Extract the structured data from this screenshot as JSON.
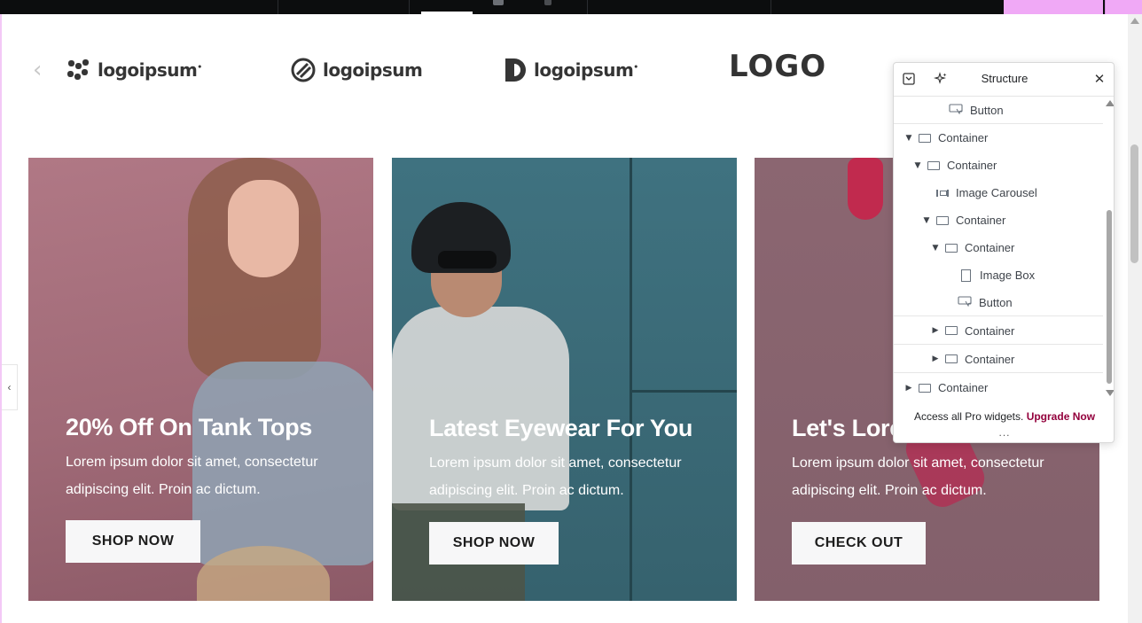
{
  "logos": {
    "logo1_text": "logoipsum",
    "logo1_mark": "•",
    "logo2_text": "logoipsum",
    "logo3_text": "logoipsum",
    "logo3_mark": "•",
    "logo4_text": "LOGO"
  },
  "cards": [
    {
      "title": "20% Off On Tank Tops",
      "desc": "Lorem ipsum dolor sit amet, consectetur adipiscing elit. Proin ac dictum.",
      "button": "SHOP NOW"
    },
    {
      "title": "Latest Eyewear For You",
      "desc": "Lorem ipsum dolor sit amet, consectetur adipiscing elit. Proin ac dictum.",
      "button": "SHOP NOW"
    },
    {
      "title": "Let's Lore",
      "desc": "Lorem ipsum dolor sit amet, consectetur adipiscing elit. Proin ac dictum.",
      "button": "CHECK OUT"
    }
  ],
  "structure_panel": {
    "title": "Structure",
    "items": [
      {
        "label": "Button",
        "depth": 3,
        "caret": "",
        "icon": "button-icon"
      },
      {
        "label": "Container",
        "depth": 0,
        "caret": "▼",
        "icon": "container-icon"
      },
      {
        "label": "Container",
        "depth": 1,
        "caret": "▼",
        "icon": "container-icon"
      },
      {
        "label": "Image Carousel",
        "depth": 2,
        "caret": "",
        "icon": "image-carousel-icon"
      },
      {
        "label": "Container",
        "depth": 2,
        "caret": "▼",
        "icon": "container-icon"
      },
      {
        "label": "Container",
        "depth": 3,
        "caret": "▼",
        "icon": "container-icon"
      },
      {
        "label": "Image Box",
        "depth": 4,
        "caret": "",
        "icon": "image-box-icon"
      },
      {
        "label": "Button",
        "depth": 4,
        "caret": "",
        "icon": "button-icon"
      },
      {
        "label": "Container",
        "depth": 3,
        "caret": "▶",
        "icon": "container-icon"
      },
      {
        "label": "Container",
        "depth": 3,
        "caret": "▶",
        "icon": "container-icon"
      },
      {
        "label": "Container",
        "depth": 0,
        "caret": "▶",
        "icon": "container-icon"
      }
    ],
    "promo_text": "Access all Pro widgets.",
    "promo_link": "Upgrade Now",
    "more": "..."
  },
  "colors": {
    "brand_accent": "#93003c",
    "canvas_border": "#f3c8f6"
  }
}
